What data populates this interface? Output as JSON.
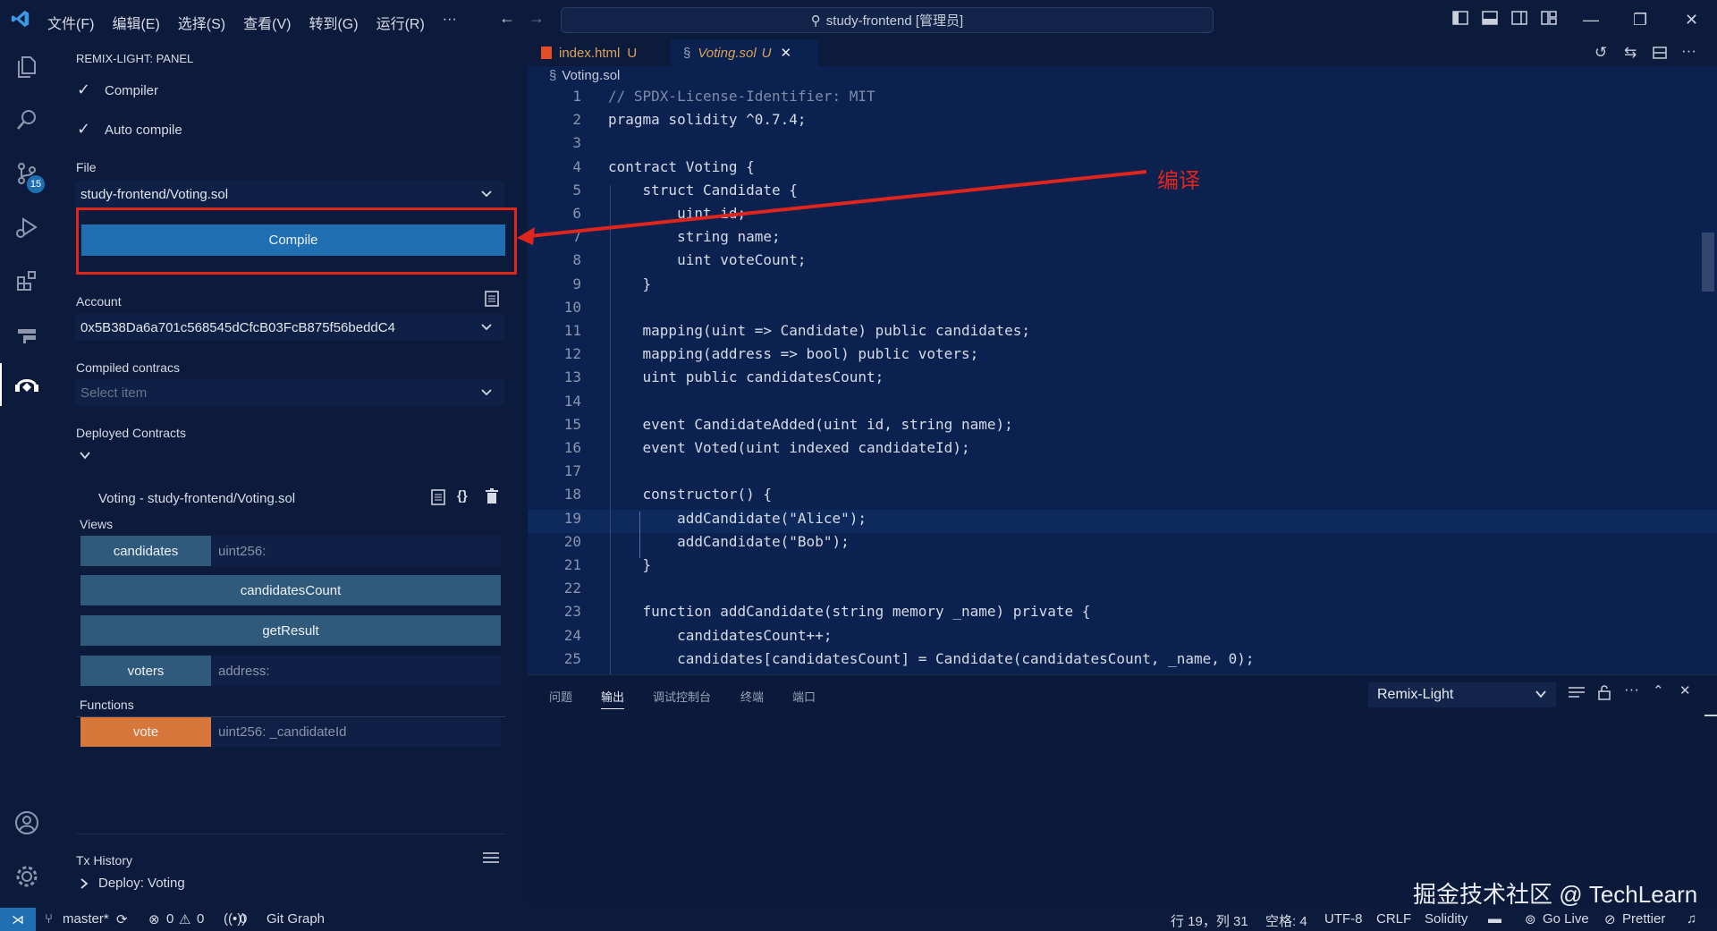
{
  "menu": [
    "文件(F)",
    "编辑(E)",
    "选择(S)",
    "查看(V)",
    "转到(G)",
    "运行(R)",
    "···"
  ],
  "window_title": "study-frontend [管理员]",
  "activity_badge": "15",
  "panel": {
    "title": "REMIX-LIGHT: PANEL",
    "compiler_label": "Compiler",
    "auto_compile_label": "Auto compile",
    "file_label": "File",
    "file_value": "study-frontend/Voting.sol",
    "compile_button": "Compile",
    "account_label": "Account",
    "account_value": "0x5B38Da6a701c568545dCfcB03FcB875f56beddC4",
    "compiled_label": "Compiled contracs",
    "compiled_placeholder": "Select item",
    "deployed_label": "Deployed Contracts",
    "deployed_item": "Voting - study-frontend/Voting.sol",
    "views_label": "Views",
    "candidates_btn": "candidates",
    "candidates_placeholder": "uint256:",
    "candidates_count_btn": "candidatesCount",
    "get_result_btn": "getResult",
    "voters_btn": "voters",
    "voters_placeholder": "address:",
    "functions_label": "Functions",
    "vote_btn": "vote",
    "vote_placeholder": "uint256: _candidateId",
    "tx_history_label": "Tx History",
    "tx_item": "Deploy: Voting"
  },
  "tabs": [
    {
      "name": "index.html",
      "status": "U"
    },
    {
      "name": "Voting.sol",
      "status": "U"
    }
  ],
  "breadcrumb": "Voting.sol",
  "code_lines": [
    "// SPDX-License-Identifier: MIT",
    "pragma solidity ^0.7.4;",
    "",
    "contract Voting {",
    "    struct Candidate {",
    "        uint id;",
    "        string name;",
    "        uint voteCount;",
    "    }",
    "",
    "    mapping(uint => Candidate) public candidates;",
    "    mapping(address => bool) public voters;",
    "    uint public candidatesCount;",
    "",
    "    event CandidateAdded(uint id, string name);",
    "    event Voted(uint indexed candidateId);",
    "",
    "    constructor() {",
    "        addCandidate(\"Alice\");",
    "        addCandidate(\"Bob\");",
    "    }",
    "",
    "    function addCandidate(string memory _name) private {",
    "        candidatesCount++;",
    "        candidates[candidatesCount] = Candidate(candidatesCount, _name, 0);"
  ],
  "bottom_panel": {
    "tabs": [
      "问题",
      "输出",
      "调试控制台",
      "终端",
      "端口"
    ],
    "active_tab": "输出",
    "output_channel": "Remix-Light"
  },
  "status": {
    "branch": "master*",
    "errors": "0",
    "warnings": "0",
    "ports": "0",
    "git_graph": "Git Graph",
    "position": "行 19，列 31",
    "spaces": "空格: 4",
    "encoding": "UTF-8",
    "eol": "CRLF",
    "language": "Solidity",
    "go_live": "Go Live",
    "prettier": "Prettier"
  },
  "annotation": "编译",
  "watermark": "掘金技术社区 @ TechLearn",
  "colors": {
    "accent": "#1f6fb2",
    "annotation": "#e0251c",
    "vote_button": "#d7773b",
    "call_button": "#2f5a7c"
  }
}
